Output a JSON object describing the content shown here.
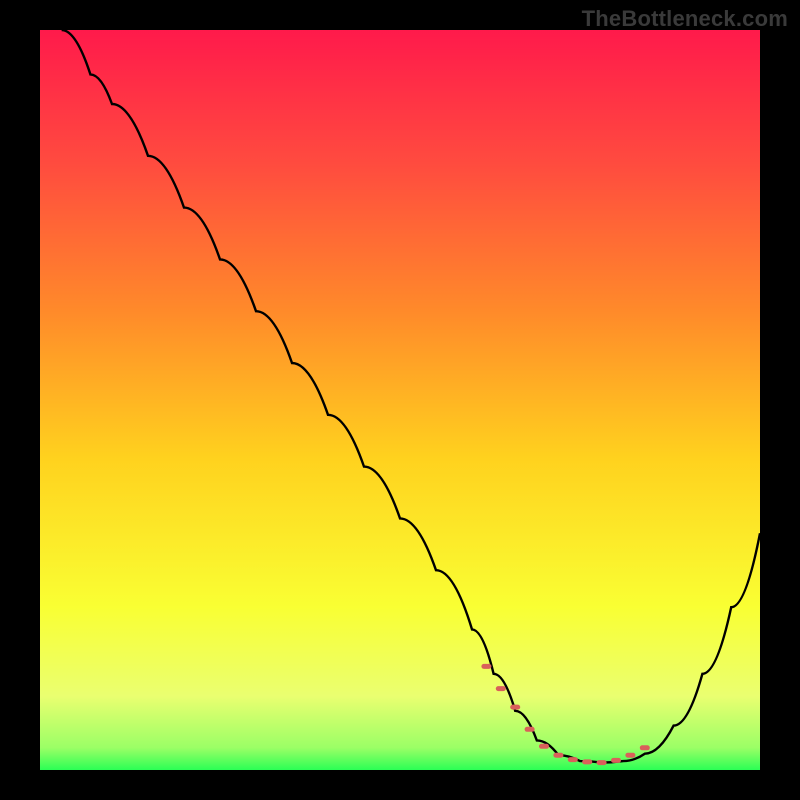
{
  "watermark": "TheBottleneck.com",
  "gradient": {
    "stops": [
      {
        "offset": "0%",
        "color": "#ff1a4b"
      },
      {
        "offset": "18%",
        "color": "#ff4b3f"
      },
      {
        "offset": "38%",
        "color": "#ff8a2a"
      },
      {
        "offset": "58%",
        "color": "#ffd21e"
      },
      {
        "offset": "78%",
        "color": "#f9ff33"
      },
      {
        "offset": "90%",
        "color": "#eaff70"
      },
      {
        "offset": "97%",
        "color": "#9bff66"
      },
      {
        "offset": "100%",
        "color": "#2bff55"
      }
    ]
  },
  "curve_color": "#000000",
  "marker_color": "#d9605a",
  "chart_data": {
    "type": "line",
    "title": "",
    "xlabel": "",
    "ylabel": "",
    "xlim": [
      0,
      100
    ],
    "ylim": [
      0,
      100
    ],
    "series": [
      {
        "name": "bottleneck-curve",
        "x": [
          3,
          7,
          10,
          15,
          20,
          25,
          30,
          35,
          40,
          45,
          50,
          55,
          60,
          63,
          66,
          69,
          72,
          75,
          78,
          81,
          84,
          88,
          92,
          96,
          100
        ],
        "values": [
          100,
          94,
          90,
          83,
          76,
          69,
          62,
          55,
          48,
          41,
          34,
          27,
          19,
          13,
          8,
          4,
          2,
          1.2,
          1,
          1.2,
          2.2,
          6,
          13,
          22,
          32
        ]
      }
    ],
    "markers": {
      "name": "highlight-points",
      "x": [
        62,
        64,
        66,
        68,
        70,
        72,
        74,
        76,
        78,
        80,
        82,
        84
      ],
      "values": [
        14,
        11,
        8.5,
        5.5,
        3.2,
        2,
        1.4,
        1.1,
        1,
        1.3,
        2,
        3
      ]
    }
  }
}
